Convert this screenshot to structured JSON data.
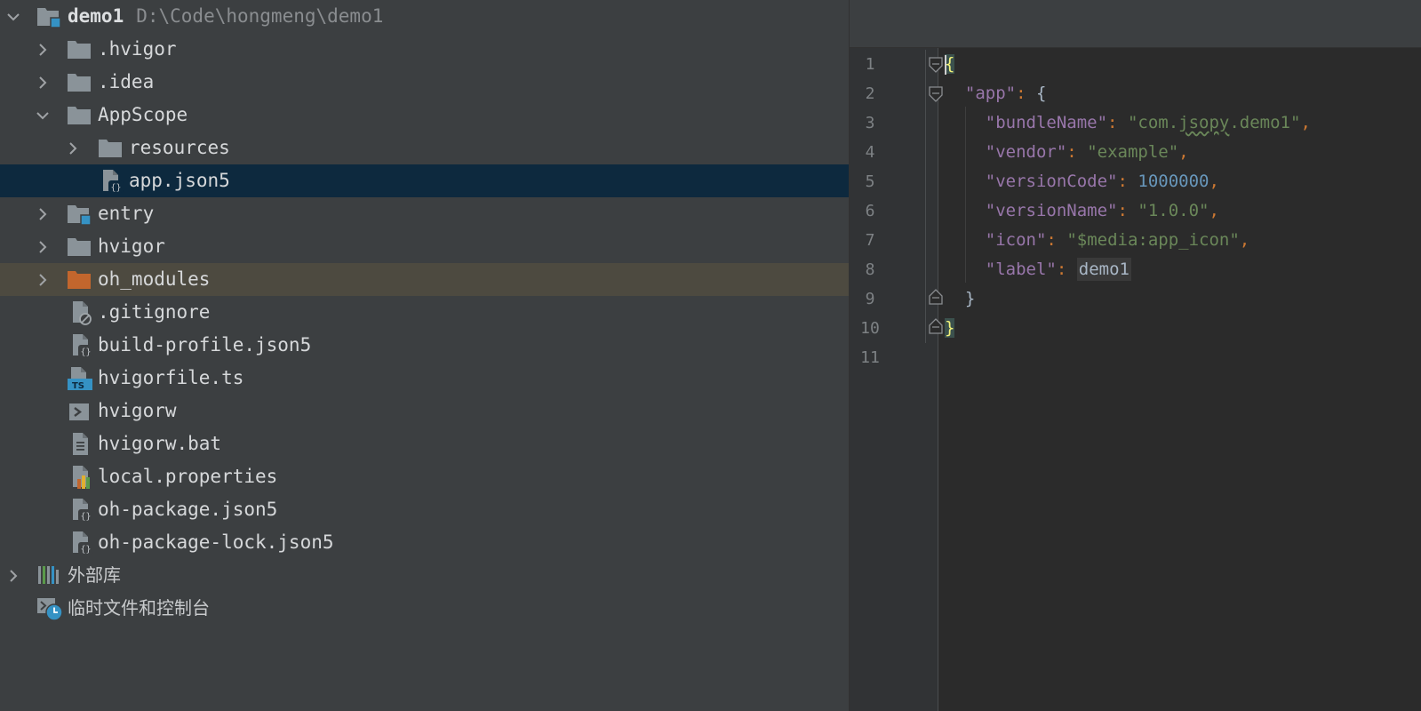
{
  "project": {
    "root_name": "demo1",
    "root_path": "D:\\Code\\hongmeng\\demo1",
    "items": [
      {
        "label": ".hvigor"
      },
      {
        "label": ".idea"
      },
      {
        "label": "AppScope"
      },
      {
        "label": "resources"
      },
      {
        "label": "app.json5"
      },
      {
        "label": "entry"
      },
      {
        "label": "hvigor"
      },
      {
        "label": "oh_modules"
      },
      {
        "label": ".gitignore"
      },
      {
        "label": "build-profile.json5"
      },
      {
        "label": "hvigorfile.ts"
      },
      {
        "label": "hvigorw"
      },
      {
        "label": "hvigorw.bat"
      },
      {
        "label": "local.properties"
      },
      {
        "label": "oh-package.json5"
      },
      {
        "label": "oh-package-lock.json5"
      }
    ],
    "external_libraries": "外部库",
    "scratches": "临时文件和控制台"
  },
  "icons": {
    "folder": "folder-icon",
    "module": "module-folder-icon",
    "excluded": "excluded-folder-icon",
    "json": "json5-file-icon",
    "ignore": "gitignore-file-icon",
    "ts": "typescript-file-icon",
    "shell": "shell-script-icon",
    "text": "text-file-icon",
    "properties": "properties-file-icon",
    "libraries": "libraries-icon",
    "scratches": "scratches-icon"
  },
  "editor": {
    "line_numbers": [
      "1",
      "2",
      "3",
      "4",
      "5",
      "6",
      "7",
      "8",
      "9",
      "10",
      "11"
    ],
    "code": {
      "open_brace": "{",
      "app_key": "\"app\"",
      "colon": ":",
      "comma": ",",
      "bundle_key": "\"bundleName\"",
      "bundle_val_a": "\"com.",
      "bundle_val_b": "jsopy",
      "bundle_val_c": ".demo1\"",
      "vendor_key": "\"vendor\"",
      "vendor_val": "\"example\"",
      "vcode_key": "\"versionCode\"",
      "vcode_val": "1000000",
      "vname_key": "\"versionName\"",
      "vname_val": "\"1.0.0\"",
      "icon_key": "\"icon\"",
      "icon_val": "\"$media:app_icon\"",
      "label_key": "\"label\"",
      "label_val": "demo1",
      "close_brace": "}"
    }
  },
  "colors": {
    "selected_row": "#0d293e",
    "excluded_row": "#4d4a40",
    "module_badge": "#3592c4",
    "excluded_folder": "#c2662d"
  }
}
